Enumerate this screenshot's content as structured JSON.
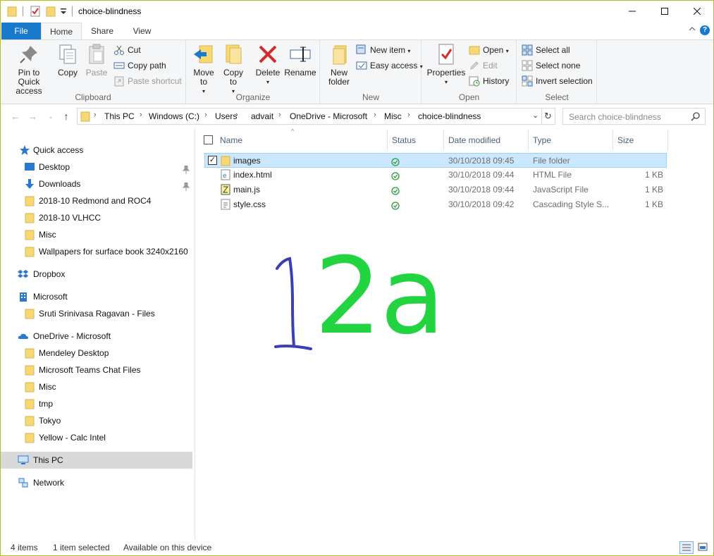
{
  "window": {
    "title": "choice-blindness"
  },
  "ribbon_tabs": {
    "file": "File",
    "home": "Home",
    "share": "Share",
    "view": "View"
  },
  "ribbon": {
    "clipboard": {
      "label": "Clipboard",
      "pin": "Pin to Quick access",
      "copy": "Copy",
      "paste": "Paste",
      "cut": "Cut",
      "copy_path": "Copy path",
      "paste_shortcut": "Paste shortcut"
    },
    "organize": {
      "label": "Organize",
      "move_to": "Move to",
      "copy_to": "Copy to",
      "delete": "Delete",
      "rename": "Rename"
    },
    "new": {
      "label": "New",
      "new_folder": "New folder",
      "new_item": "New item",
      "easy_access": "Easy access"
    },
    "open": {
      "label": "Open",
      "properties": "Properties",
      "open": "Open",
      "edit": "Edit",
      "history": "History"
    },
    "select": {
      "label": "Select",
      "select_all": "Select all",
      "select_none": "Select none",
      "invert": "Invert selection"
    }
  },
  "address": {
    "crumbs": [
      "This PC",
      "Windows (C:)",
      "Users",
      "advait",
      "OneDrive - Microsoft",
      "Misc",
      "choice-blindness"
    ],
    "search_placeholder": "Search choice-blindness"
  },
  "nav": {
    "quick_access": "Quick access",
    "qa_items": [
      "Desktop",
      "Downloads",
      "2018-10 Redmond and ROC4",
      "2018-10 VLHCC",
      "Misc",
      "Wallpapers for surface book 3240x2160"
    ],
    "dropbox": "Dropbox",
    "microsoft": "Microsoft",
    "ms_items": [
      "Sruti Srinivasa Ragavan - Files"
    ],
    "onedrive": "OneDrive - Microsoft",
    "od_items": [
      "Mendeley Desktop",
      "Microsoft Teams Chat Files",
      "Misc",
      "tmp",
      "Tokyo",
      "Yellow - Calc Intel"
    ],
    "this_pc": "This PC",
    "network": "Network"
  },
  "columns": {
    "name": "Name",
    "status": "Status",
    "date": "Date modified",
    "type": "Type",
    "size": "Size"
  },
  "files": [
    {
      "name": "images",
      "date": "30/10/2018 09:45",
      "type": "File folder",
      "size": "",
      "icon": "folder-icon"
    },
    {
      "name": "index.html",
      "date": "30/10/2018 09:44",
      "type": "HTML File",
      "size": "1 KB",
      "icon": "html-file-icon"
    },
    {
      "name": "main.js",
      "date": "30/10/2018 09:44",
      "type": "JavaScript File",
      "size": "1 KB",
      "icon": "js-file-icon"
    },
    {
      "name": "style.css",
      "date": "30/10/2018 09:42",
      "type": "Cascading Style S...",
      "size": "1 KB",
      "icon": "css-file-icon"
    }
  ],
  "statusbar": {
    "items": "4 items",
    "selected": "1 item selected",
    "availability": "Available on this device"
  },
  "annotation": {
    "number": "1",
    "label": "2a"
  },
  "colors": {
    "accent": "#1979ca",
    "window_border": "#b5bf1f",
    "selection": "#cce8ff",
    "annotation_green": "#22d440",
    "annotation_blue": "#3b3fb5"
  }
}
